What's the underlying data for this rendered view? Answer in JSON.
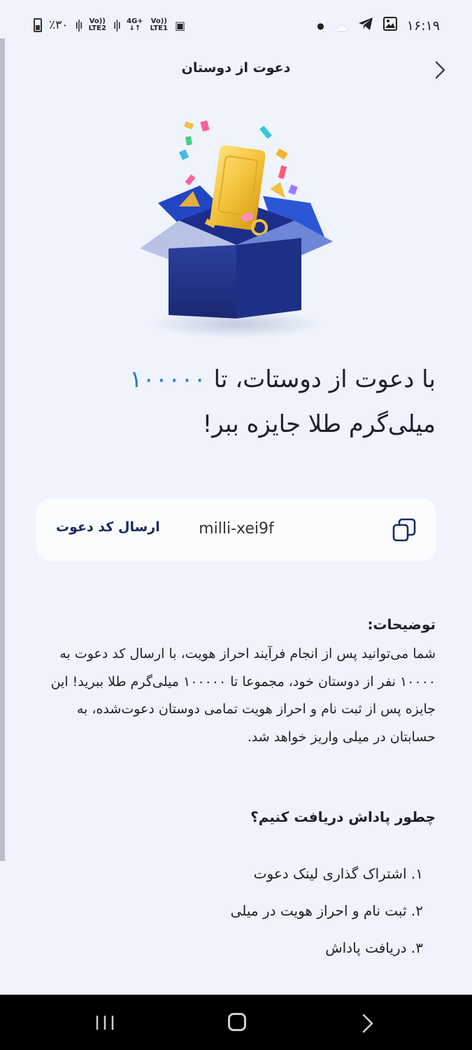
{
  "status_bar": {
    "battery_text": "٪۳۰",
    "sim2_label": "LTE2",
    "sim2_top": "Vo))",
    "sim1_top": "Vo))",
    "sim1_label": "LTE1",
    "net_type": "4G+",
    "time": "۱۶:۱۹"
  },
  "header": {
    "title": "دعوت از دوستان"
  },
  "headline": {
    "part1": "با دعوت از دوستات، تا ",
    "amount": "۱۰۰۰۰۰",
    "part2": "میلی‌گرم طلا جایزه ببر!"
  },
  "invite_card": {
    "send_label": "ارسال کد دعوت",
    "code": "milli-xei9f"
  },
  "description": {
    "title": "توضیحات:",
    "body": "شما می‌توانید پس از انجام فرآیند احراز هویت، با ارسال کد دعوت به ۱۰۰۰۰ نفر از دوستان خود، مجموعا تا ۱۰۰۰۰۰ میلی‌گرم طلا ببرید! این جایزه پس از ثبت نام و احراز هویت تمامی دوستان دعوت‌شده، به حسابتان در میلی واریز خواهد شد."
  },
  "how_to": {
    "title": "چطور پاداش دریافت کنیم؟",
    "steps": [
      "۱. اشتراک گذاری لینک دعوت",
      "۲. ثبت نام و احراز هویت در میلی",
      "۳. دریافت پاداش"
    ]
  },
  "colors": {
    "background": "#eef3fc",
    "accent": "#2f79c9",
    "card": "#fbfcfe",
    "button_text": "#1b2a5c"
  }
}
